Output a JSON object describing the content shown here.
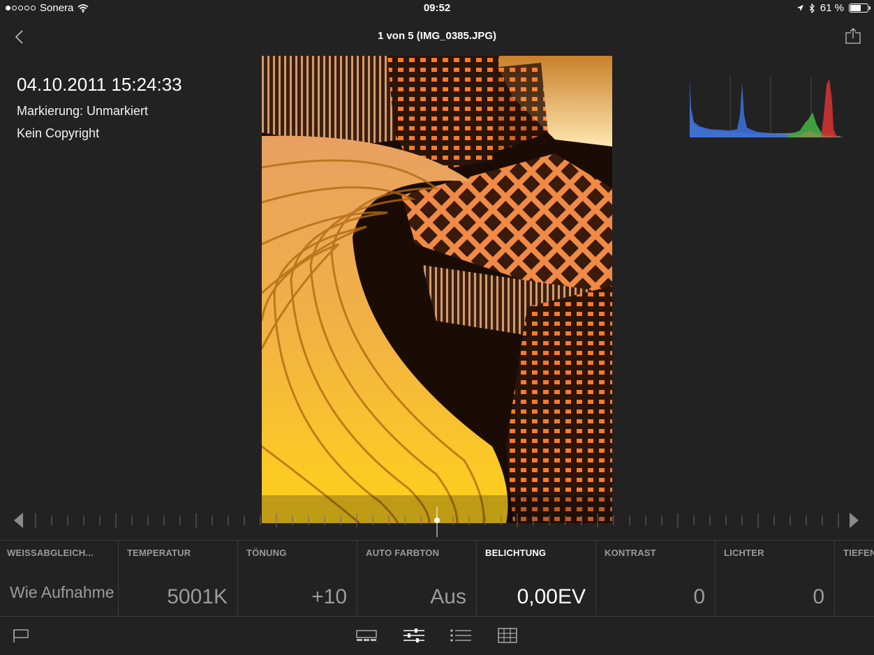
{
  "status_bar": {
    "carrier": "Sonera",
    "time": "09:52",
    "battery_percent": "61 %",
    "battery_level": 0.61,
    "signal_dots_filled": 1,
    "signal_dots_total": 5
  },
  "nav": {
    "title": "1 von 5 (IMG_0385.JPG)",
    "back_icon": "chevron-left-icon",
    "share_icon": "share-icon"
  },
  "info": {
    "date": "04.10.2011 15:24:33",
    "flag": "Markierung: Unmarkiert",
    "copyright": "Kein Copyright"
  },
  "histogram": {
    "colors": {
      "blue": "#3a6fd8",
      "green": "#3fa63f",
      "red": "#c83232",
      "gray": "#8a8a8a"
    }
  },
  "slider": {
    "value": 0.0,
    "left_icon": "triangle-left-icon",
    "right_icon": "triangle-right-icon"
  },
  "params": [
    {
      "label": "WEISSABGLEICH...",
      "value": "Wie Aufnahme"
    },
    {
      "label": "TEMPERATUR",
      "value": "5001K"
    },
    {
      "label": "TÖNUNG",
      "value": "+10"
    },
    {
      "label": "AUTO FARBTON",
      "value": "Aus"
    },
    {
      "label": "BELICHTUNG",
      "value": "0,00EV",
      "active": true
    },
    {
      "label": "KONTRAST",
      "value": "0"
    },
    {
      "label": "LICHTER",
      "value": "0"
    },
    {
      "label": "TIEFEN",
      "value": ""
    }
  ],
  "toolbar": {
    "flag_icon": "flag-icon",
    "filmstrip_icon": "filmstrip-icon",
    "adjust_icon": "sliders-icon",
    "list_icon": "list-icon",
    "crop_icon": "crop-grid-icon"
  },
  "colors": {
    "background": "#222222",
    "divider": "#3a3a3a",
    "inactive_text": "#9a9a9a",
    "active_text": "#ffffff"
  }
}
